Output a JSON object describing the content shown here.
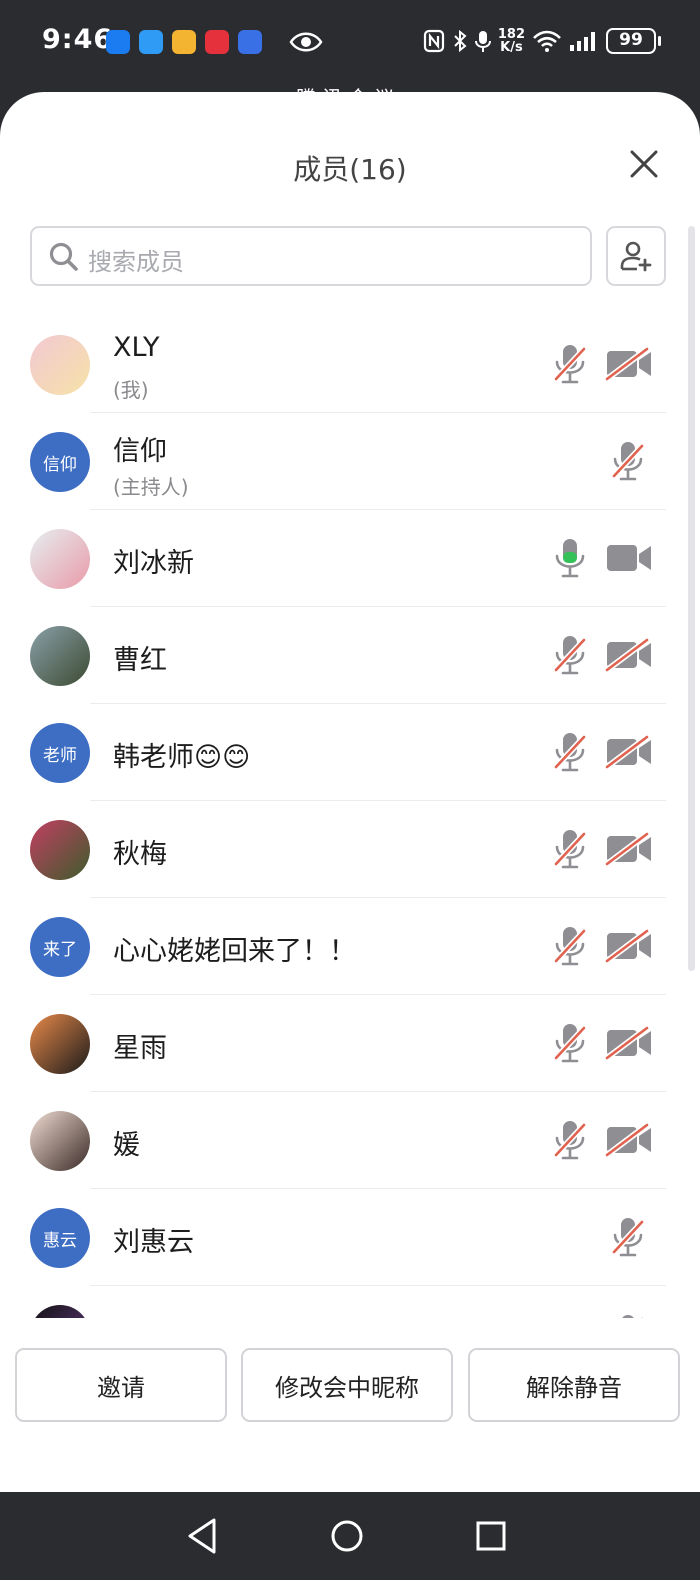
{
  "status_bar": {
    "time": "9:46",
    "speed_value": "182",
    "speed_unit": "K/s",
    "battery": "99",
    "peek_title": "腾讯会议",
    "icons": [
      "nfc-icon",
      "bluetooth-icon",
      "mic-status-icon",
      "wifi-icon",
      "signal-icon"
    ]
  },
  "sheet": {
    "title": "成员(16)",
    "search_placeholder": "搜索成员"
  },
  "members": [
    {
      "name": "XLY",
      "subtitle": "(我)",
      "avatar_type": "photo",
      "avatar_colors": [
        "#f2c8d2",
        "#f6e2a8"
      ],
      "mic": "muted",
      "camera": "off"
    },
    {
      "name": "信仰",
      "subtitle": "(主持人)",
      "avatar_type": "text",
      "avatar_text": "信仰",
      "mic": "muted",
      "camera": "none"
    },
    {
      "name": "刘冰新",
      "subtitle": "",
      "avatar_type": "photo",
      "avatar_colors": [
        "#e6eef0",
        "#e89aa8"
      ],
      "mic": "active",
      "camera": "on"
    },
    {
      "name": "曹红",
      "subtitle": "",
      "avatar_type": "photo",
      "avatar_colors": [
        "#8aa0a8",
        "#3c4a32"
      ],
      "mic": "muted",
      "camera": "off"
    },
    {
      "name": "韩老师😊😊",
      "subtitle": "",
      "avatar_type": "text",
      "avatar_text": "老师",
      "mic": "muted",
      "camera": "off"
    },
    {
      "name": "秋梅",
      "subtitle": "",
      "avatar_type": "photo",
      "avatar_colors": [
        "#c23f62",
        "#3d5c2c"
      ],
      "mic": "muted",
      "camera": "off"
    },
    {
      "name": "心心姥姥回来了！！",
      "subtitle": "",
      "avatar_type": "text",
      "avatar_text": "来了",
      "mic": "muted",
      "camera": "off"
    },
    {
      "name": "星雨",
      "subtitle": "",
      "avatar_type": "photo",
      "avatar_colors": [
        "#e88a4a",
        "#1a1a1a"
      ],
      "mic": "muted",
      "camera": "off"
    },
    {
      "name": "媛",
      "subtitle": "",
      "avatar_type": "photo",
      "avatar_colors": [
        "#f0dcd2",
        "#3a2a26"
      ],
      "mic": "muted",
      "camera": "off"
    },
    {
      "name": "刘惠云",
      "subtitle": "",
      "avatar_type": "text",
      "avatar_text": "惠云",
      "mic": "muted",
      "camera": "none"
    },
    {
      "name": "",
      "subtitle": "",
      "avatar_type": "photo",
      "avatar_colors": [
        "#111111",
        "#6b3d8a"
      ],
      "mic": "muted",
      "camera": "none"
    }
  ],
  "footer": {
    "invite": "邀请",
    "rename": "修改会中昵称",
    "unmute": "解除静音"
  },
  "colors": {
    "accent": "#3e6ec4",
    "mic_active": "#35c15a",
    "muted_slash": "#e0624f",
    "icon_gray": "#8e8e93"
  }
}
